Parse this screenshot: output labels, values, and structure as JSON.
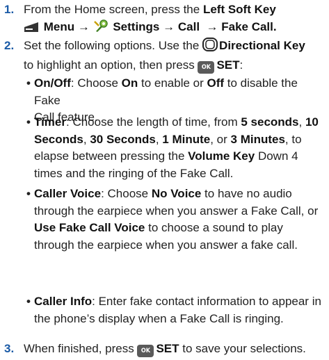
{
  "steps": [
    {
      "number": "1.",
      "line1": {
        "pre": "From the Home screen, press the ",
        "key": "Left Soft Key"
      },
      "line2": {
        "menu": "Menu",
        "arrow1": "→",
        "settings": "Settings",
        "arrow2": "→",
        "call": "Call",
        "arrow3": "→",
        "fake_call": "Fake Call."
      }
    },
    {
      "number": "2.",
      "line1": {
        "pre": "Set the following options. Use the ",
        "key": "Directional Key"
      },
      "line2": {
        "pre": "to highlight an option, then press ",
        "ok_label": "OK",
        "set": "SET",
        "post": ":"
      }
    },
    {
      "number": "3.",
      "pre": "When finished, press ",
      "ok_label": "OK",
      "set": "SET",
      "post": " to save your selections."
    }
  ],
  "options": [
    {
      "lines": [
        [
          {
            "t": "On/Off",
            "b": true
          },
          {
            "t": ": Choose "
          },
          {
            "t": "On",
            "b": true
          },
          {
            "t": " to enable or "
          },
          {
            "t": "Off",
            "b": true
          },
          {
            "t": " to disable the Fake"
          }
        ],
        [
          {
            "t": "Call feature."
          }
        ]
      ]
    },
    {
      "lines": [
        [
          {
            "t": "Timer",
            "b": true
          },
          {
            "t": ": Choose the length of time, from "
          },
          {
            "t": "5 seconds",
            "b": true
          },
          {
            "t": ", "
          },
          {
            "t": "10",
            "b": true
          }
        ],
        [
          {
            "t": "Seconds",
            "b": true
          },
          {
            "t": ", "
          },
          {
            "t": "30 Seconds",
            "b": true
          },
          {
            "t": ", "
          },
          {
            "t": "1 Minute",
            "b": true
          },
          {
            "t": ", or "
          },
          {
            "t": "3 Minutes",
            "b": true
          },
          {
            "t": ", to"
          }
        ],
        [
          {
            "t": "elapse between pressing the "
          },
          {
            "t": "Volume Key",
            "b": true
          },
          {
            "t": " Down 4"
          }
        ],
        [
          {
            "t": "times and the ringing of the Fake Call."
          }
        ]
      ]
    },
    {
      "lines": [
        [
          {
            "t": "Caller Voice",
            "b": true
          },
          {
            "t": ": Choose "
          },
          {
            "t": "No Voice",
            "b": true
          },
          {
            "t": " to have no audio"
          }
        ],
        [
          {
            "t": "through the earpiece when you answer a Fake Call, or"
          }
        ],
        [
          {
            "t": "Use Fake Call Voice",
            "b": true
          },
          {
            "t": " to choose a sound to play"
          }
        ],
        [
          {
            "t": "through the earpiece when you answer a fake call."
          }
        ]
      ]
    },
    {
      "lines": [
        [
          {
            "t": "Caller Info",
            "b": true
          },
          {
            "t": ": Enter fake contact information to appear in"
          }
        ],
        [
          {
            "t": "the phone’s display when a Fake Call is ringing."
          }
        ]
      ]
    }
  ],
  "bullet_char": "•",
  "colors": {
    "step_number": "#1a5aa6",
    "text": "#222222",
    "ok_button": "#5a5a5a"
  },
  "icons": [
    "soft-key-icon",
    "settings-icon",
    "directional-key-icon",
    "ok-key-icon"
  ]
}
